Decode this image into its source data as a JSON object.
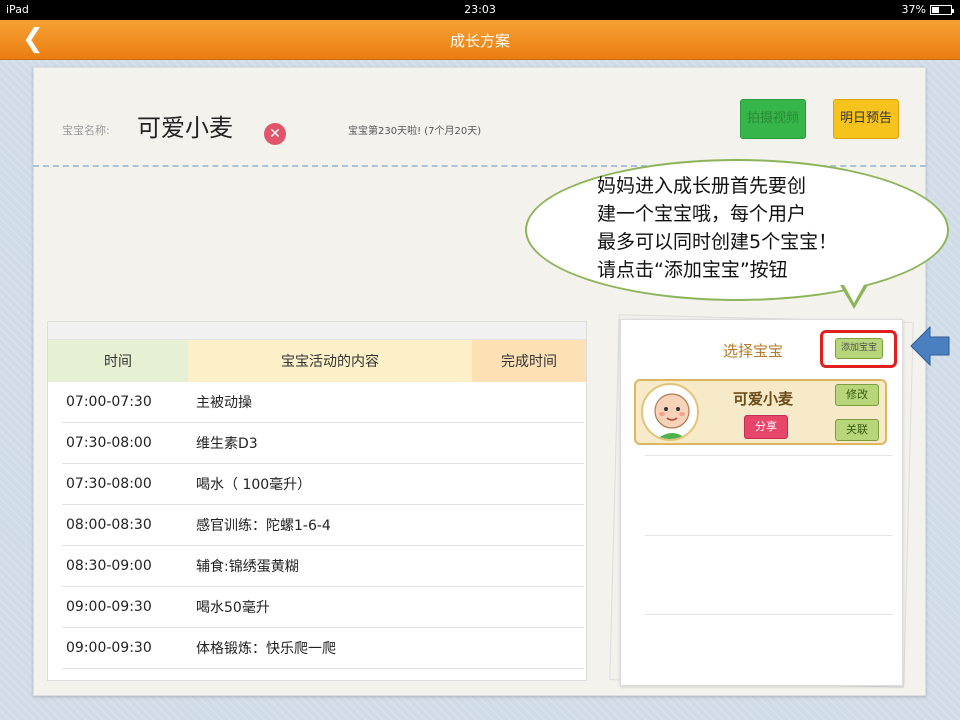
{
  "status_bar": {
    "device": "iPad",
    "time": "23:03",
    "battery": "37%",
    "battery_level": 0.37
  },
  "nav": {
    "title": "成长方案",
    "back_icon": "chevron-left-icon"
  },
  "baby": {
    "label": "宝宝名称:",
    "name": "可爱小麦",
    "age_text": "宝宝第230天啦! (7个月20天)"
  },
  "actions": {
    "green_label": "拍摄视频",
    "tomorrow_label": "明日预告"
  },
  "bubble": {
    "lines": [
      "妈妈进入成长册首先要创",
      "建一个宝宝哦，每个用户",
      "最多可以同时创建5个宝宝！",
      "请点击“添加宝宝”按钮"
    ]
  },
  "table": {
    "headers": [
      "时间",
      "宝宝活动的内容",
      "完成时间"
    ],
    "rows": [
      {
        "time": "07:00-07:30",
        "content": "主被动操"
      },
      {
        "time": "07:30-08:00",
        "content": "维生素D3"
      },
      {
        "time": "07:30-08:00",
        "content": "喝水（ 100毫升）"
      },
      {
        "time": "08:00-08:30",
        "content": "感官训练：陀螺1-6-4"
      },
      {
        "time": "08:30-09:00",
        "content": "辅食:锦绣蛋黄糊"
      },
      {
        "time": "09:00-09:30",
        "content": "喝水50毫升"
      },
      {
        "time": "09:00-09:30",
        "content": "体格锻炼：快乐爬一爬"
      }
    ]
  },
  "select_panel": {
    "title": "选择宝宝",
    "add_button": "添加宝宝",
    "card": {
      "name": "可爱小麦",
      "share": "分享",
      "edit": "修改",
      "unlink": "关联"
    }
  },
  "colors": {
    "nav": "#ef8a1d",
    "highlight": "#e02020",
    "arrow": "#4a7fc0"
  }
}
